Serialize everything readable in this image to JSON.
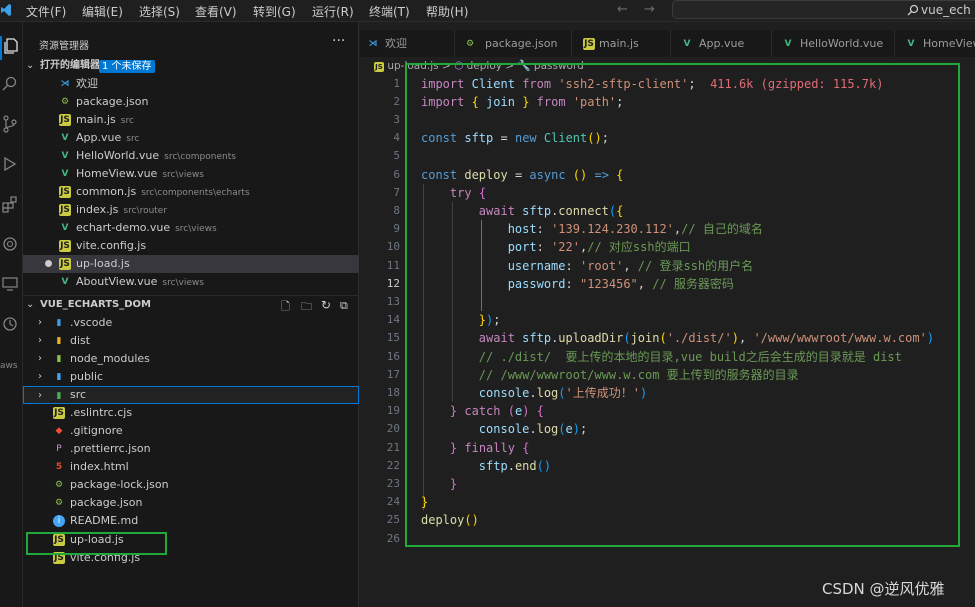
{
  "menu": [
    "文件(F)",
    "编辑(E)",
    "选择(S)",
    "查看(V)",
    "转到(G)",
    "运行(R)",
    "终端(T)",
    "帮助(H)"
  ],
  "search_text": "vue_ech",
  "sidebar": {
    "title": "资源管理器",
    "more": "···",
    "open_editors": {
      "label": "打开的编辑器",
      "badge": "1 个未保存"
    },
    "open_files": [
      {
        "name": "欢迎",
        "path": "",
        "icon": "vscode-icon"
      },
      {
        "name": "package.json",
        "path": "",
        "icon": "json-icon"
      },
      {
        "name": "main.js",
        "path": "src",
        "icon": "js-icon"
      },
      {
        "name": "App.vue",
        "path": "src",
        "icon": "vue-icon"
      },
      {
        "name": "HelloWorld.vue",
        "path": "src\\components",
        "icon": "vue-icon"
      },
      {
        "name": "HomeView.vue",
        "path": "src\\views",
        "icon": "vue-icon"
      },
      {
        "name": "common.js",
        "path": "src\\components\\echarts",
        "icon": "js-icon"
      },
      {
        "name": "index.js",
        "path": "src\\router",
        "icon": "js-icon"
      },
      {
        "name": "echart-demo.vue",
        "path": "src\\views",
        "icon": "vue-icon"
      },
      {
        "name": "vite.config.js",
        "path": "",
        "icon": "js-icon"
      },
      {
        "name": "up-load.js",
        "path": "",
        "icon": "js-icon"
      },
      {
        "name": "AboutView.vue",
        "path": "src\\views",
        "icon": "vue-icon"
      }
    ],
    "project": {
      "label": "VUE_ECHARTS_DOM"
    },
    "tree": [
      {
        "name": ".vscode",
        "folder": true
      },
      {
        "name": "dist",
        "folder": true
      },
      {
        "name": "node_modules",
        "folder": true
      },
      {
        "name": "public",
        "folder": true
      },
      {
        "name": "src",
        "folder": true
      },
      {
        "name": ".eslintrc.cjs",
        "folder": false
      },
      {
        "name": ".gitignore",
        "folder": false
      },
      {
        "name": ".prettierrc.json",
        "folder": false
      },
      {
        "name": "index.html",
        "folder": false
      },
      {
        "name": "package-lock.json",
        "folder": false
      },
      {
        "name": "package.json",
        "folder": false
      },
      {
        "name": "README.md",
        "folder": false
      },
      {
        "name": "up-load.js",
        "folder": false
      },
      {
        "name": "vite.config.js",
        "folder": false
      }
    ]
  },
  "tabs": [
    {
      "label": "欢迎",
      "icon": "vscode-icon"
    },
    {
      "label": "package.json",
      "icon": "json-icon"
    },
    {
      "label": "main.js",
      "icon": "js-icon"
    },
    {
      "label": "App.vue",
      "icon": "vue-icon"
    },
    {
      "label": "HelloWorld.vue",
      "icon": "vue-icon"
    },
    {
      "label": "HomeView.vue",
      "icon": "vue-icon"
    }
  ],
  "breadcrumbs": {
    "file": "up-load.js",
    "sep": ">",
    "fn": "deploy",
    "prop": "password"
  },
  "code": {
    "line_numbers": [
      "1",
      "2",
      "3",
      "4",
      "5",
      "6",
      "7",
      "8",
      "9",
      "10",
      "11",
      "12",
      "13",
      "14",
      "15",
      "16",
      "17",
      "18",
      "19",
      "20",
      "21",
      "22",
      "23",
      "24",
      "25",
      "26"
    ],
    "current_line": "12",
    "import_size": "411.6k (gzipped: 115.7k)"
  },
  "watermark": "CSDN @逆风优雅",
  "colors": {
    "highlight": "#22a83a",
    "accent": "#0078d4"
  }
}
